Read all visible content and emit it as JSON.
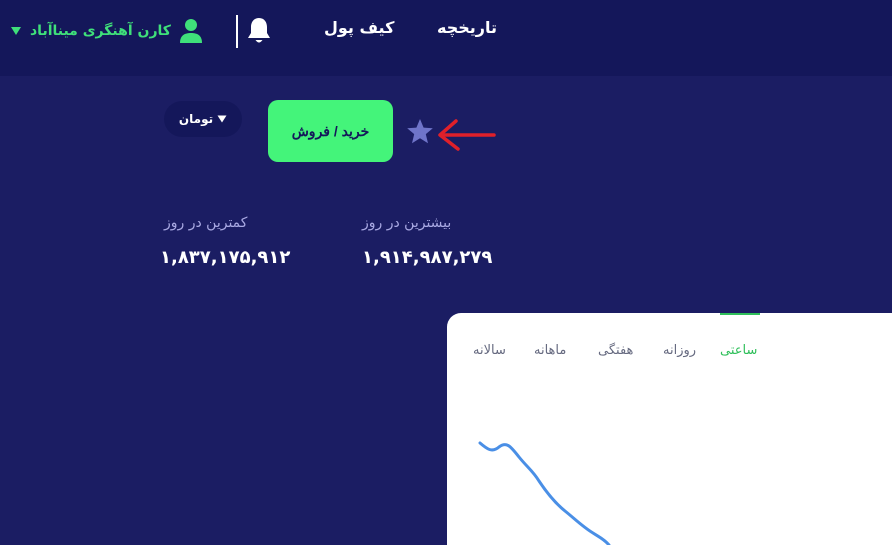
{
  "header": {
    "nav": [
      {
        "label": "تاریخچه"
      },
      {
        "label": "کیف پول"
      }
    ],
    "user": {
      "name": "کارن آهنگری میناآباد"
    },
    "colors": {
      "bar": "#14175a",
      "accent": "#3fe07a"
    }
  },
  "toolbar": {
    "currency_label": "تومان",
    "trade_label": "خرید / فروش",
    "colors": {
      "trade": "#44f47a",
      "star": "#6f74c9",
      "arrow": "#e0202a"
    }
  },
  "stats": {
    "high": {
      "label": "بیشترین در روز",
      "value": "۱,۹۱۴,۹۸۷,۲۷۹"
    },
    "low": {
      "label": "کمترین در روز",
      "value": "۱,۸۳۷,۱۷۵,۹۱۲"
    }
  },
  "chart": {
    "tabs": [
      {
        "label": "ساعتی",
        "active": true
      },
      {
        "label": "روزانه",
        "active": false
      },
      {
        "label": "هفتگی",
        "active": false
      },
      {
        "label": "ماهانه",
        "active": false
      },
      {
        "label": "سالانه",
        "active": false
      }
    ],
    "line_color": "#4a8fe6"
  }
}
